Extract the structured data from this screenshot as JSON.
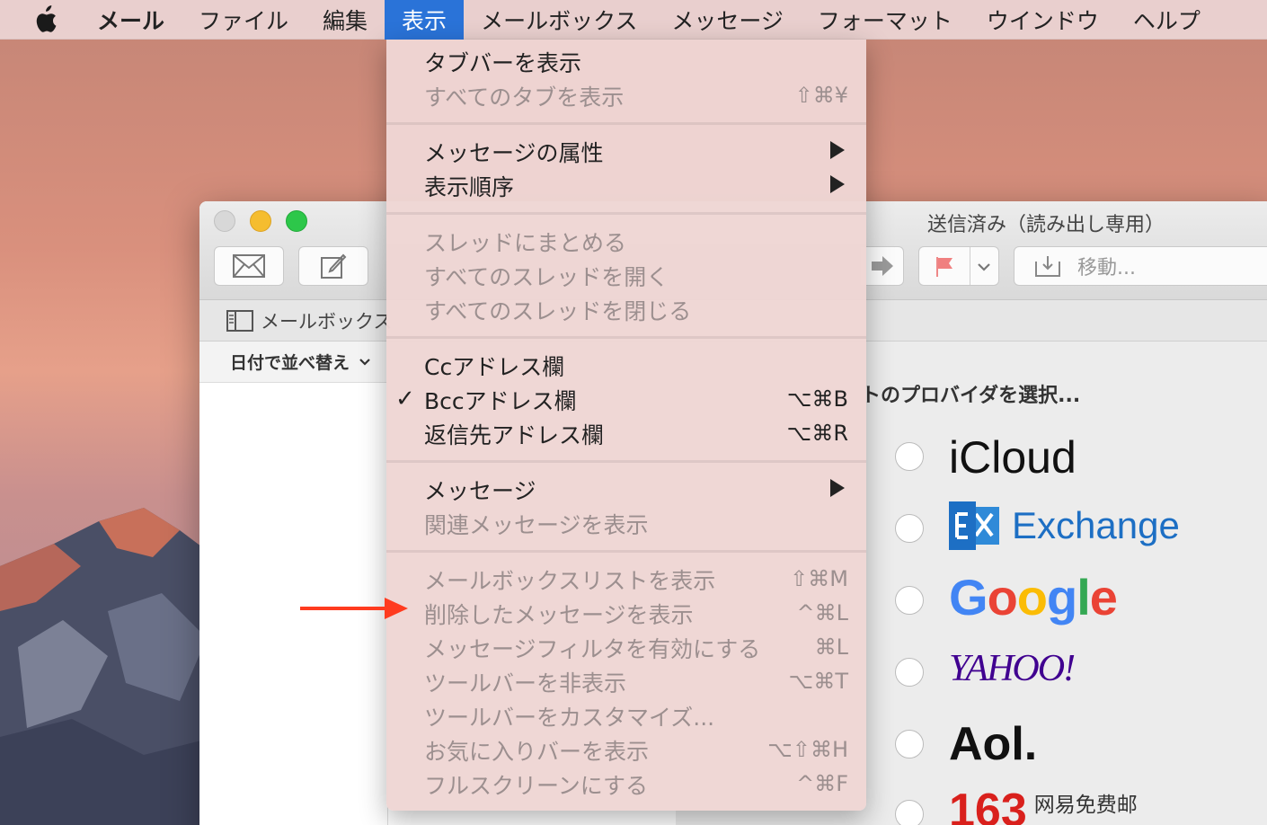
{
  "menubar": {
    "app": "メール",
    "items": [
      "ファイル",
      "編集",
      "表示",
      "メールボックス",
      "メッセージ",
      "フォーマット",
      "ウインドウ",
      "ヘルプ"
    ],
    "active_index": 2
  },
  "window": {
    "title": "送信済み（読み出し専用）",
    "mailbox_toggle_label": "メールボックス",
    "sort_label": "日付で並べ替え",
    "move_label": "移動...",
    "provider_prompt": "トのプロバイダを選択...",
    "providers": {
      "icloud": "iCloud",
      "exchange": "Exchange",
      "google": "Google",
      "yahoo": "YAHOO!",
      "aol": "Aol.",
      "n163_num": "163",
      "n163_cn": "网易免费邮"
    }
  },
  "menu": {
    "items": [
      {
        "label": "タブバーを表示",
        "shortcut": "",
        "disabled": false
      },
      {
        "label": "すべてのタブを表示",
        "shortcut": "⇧⌘¥",
        "disabled": true
      },
      {
        "label": "メッセージの属性",
        "shortcut": "",
        "disabled": false,
        "submenu": true
      },
      {
        "label": "表示順序",
        "shortcut": "",
        "disabled": false,
        "submenu": true
      },
      {
        "label": "スレッドにまとめる",
        "shortcut": "",
        "disabled": true
      },
      {
        "label": "すべてのスレッドを開く",
        "shortcut": "",
        "disabled": true
      },
      {
        "label": "すべてのスレッドを閉じる",
        "shortcut": "",
        "disabled": true
      },
      {
        "label": "Ccアドレス欄",
        "shortcut": "",
        "disabled": false
      },
      {
        "label": "Bccアドレス欄",
        "shortcut": "⌥⌘B",
        "disabled": false,
        "checked": true
      },
      {
        "label": "返信先アドレス欄",
        "shortcut": "⌥⌘R",
        "disabled": false
      },
      {
        "label": "メッセージ",
        "shortcut": "",
        "disabled": false,
        "submenu": true
      },
      {
        "label": "関連メッセージを表示",
        "shortcut": "",
        "disabled": true
      },
      {
        "label": "メールボックスリストを表示",
        "shortcut": "⇧⌘M",
        "disabled": true
      },
      {
        "label": "削除したメッセージを表示",
        "shortcut": "^⌘L",
        "disabled": true
      },
      {
        "label": "メッセージフィルタを有効にする",
        "shortcut": "⌘L",
        "disabled": true
      },
      {
        "label": "ツールバーを非表示",
        "shortcut": "⌥⌘T",
        "disabled": true
      },
      {
        "label": "ツールバーをカスタマイズ...",
        "shortcut": "",
        "disabled": true
      },
      {
        "label": "お気に入りバーを表示",
        "shortcut": "⌥⇧⌘H",
        "disabled": true
      },
      {
        "label": "フルスクリーンにする",
        "shortcut": "^⌘F",
        "disabled": true
      }
    ],
    "check_mark": "✓"
  },
  "colors": {
    "menu_highlight": "#2a73d8",
    "annotation_arrow": "#ff3b1f",
    "exchange_blue": "#1d6fc4",
    "yahoo_purple": "#400090",
    "n163_red": "#d9201c"
  },
  "icons": [
    "apple-logo-icon",
    "envelope-icon",
    "compose-icon",
    "forward-arrow-icon",
    "flag-icon",
    "chevron-down-icon",
    "move-icon",
    "sidebar-icon",
    "exchange-logo-icon",
    "red-arrow-annotation"
  ]
}
